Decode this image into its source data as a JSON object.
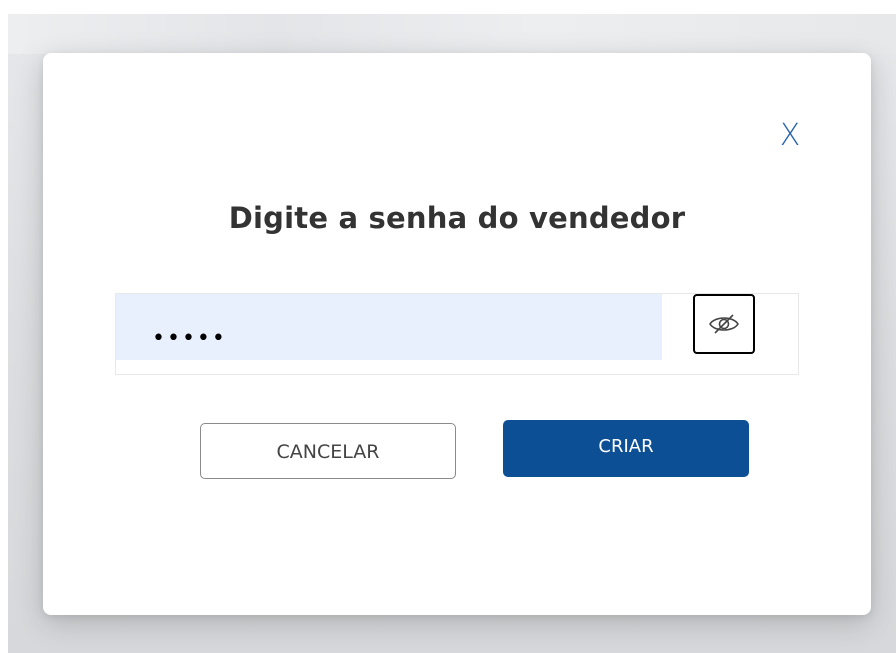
{
  "modal": {
    "close_label": "X",
    "title": "Digite a senha do vendedor",
    "password": {
      "value": "•••••",
      "masked": true,
      "toggle_icon": "eye-slash-icon"
    },
    "buttons": {
      "cancel_label": "CANCELAR",
      "create_label": "CRIAR"
    }
  },
  "colors": {
    "accent": "#0d4f94",
    "close": "#2a64ad",
    "input_bg": "#e8f0fe"
  }
}
